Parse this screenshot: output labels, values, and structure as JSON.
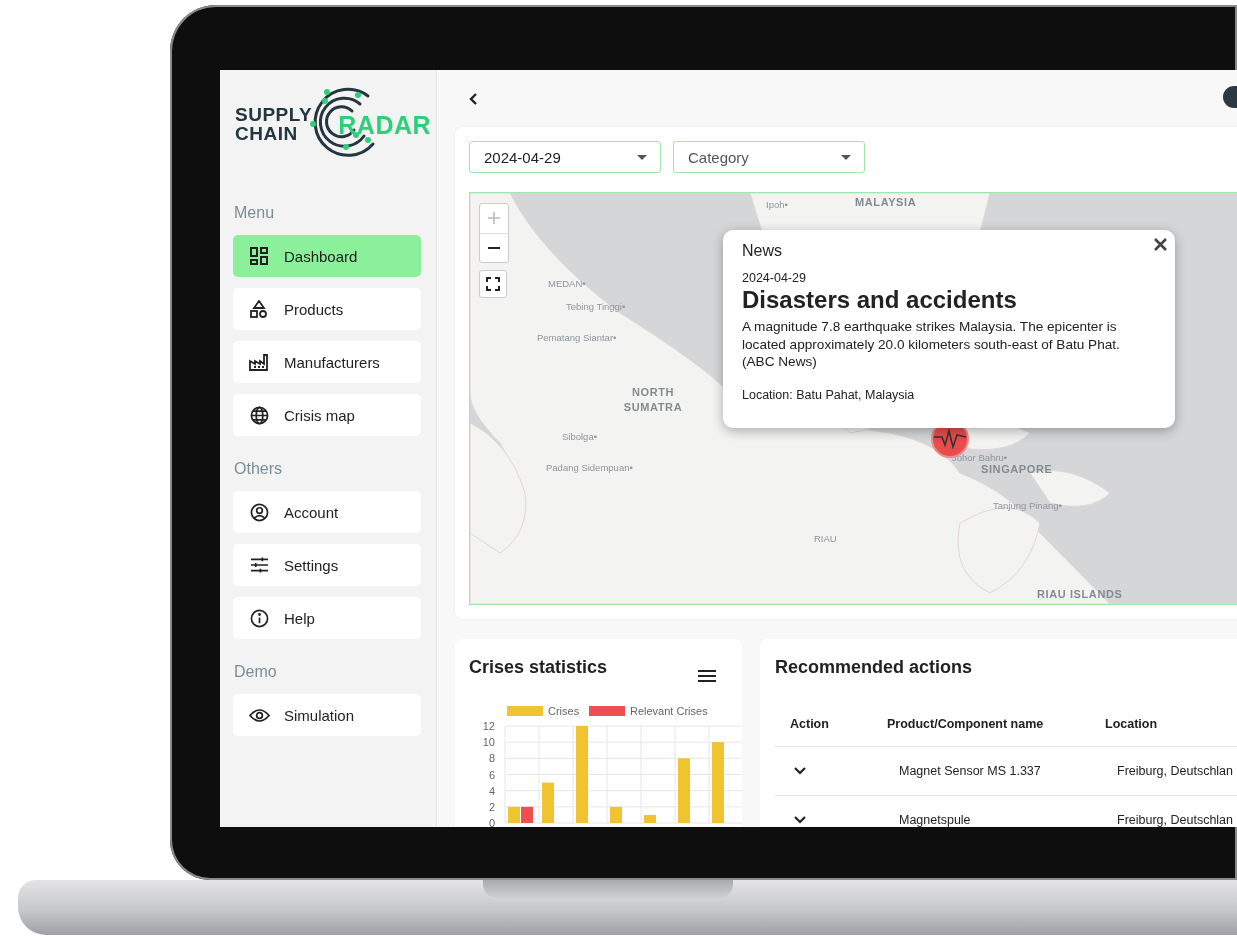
{
  "logo": {
    "line_1": "SUPPLY",
    "line_2": "CHAIN",
    "line_3": "RADAR"
  },
  "sidebar": {
    "sections": [
      {
        "heading": "Menu",
        "items": [
          {
            "label": "Dashboard",
            "selected": true
          },
          {
            "label": "Products",
            "selected": false
          },
          {
            "label": "Manufacturers",
            "selected": false
          },
          {
            "label": "Crisis map",
            "selected": false
          }
        ]
      },
      {
        "heading": "Others",
        "items": [
          {
            "label": "Account",
            "selected": false
          },
          {
            "label": "Settings",
            "selected": false
          },
          {
            "label": "Help",
            "selected": false
          }
        ]
      },
      {
        "heading": "Demo",
        "items": [
          {
            "label": "Simulation",
            "selected": false
          }
        ]
      }
    ]
  },
  "filters": {
    "date_select": {
      "value": "2024-04-29"
    },
    "category_select": {
      "placeholder": "Category"
    }
  },
  "map": {
    "labels": [
      "Ipoh•",
      "MALAYSIA",
      "MEDAN•",
      "Tebing Tinggi•",
      "Pematang Siantar•",
      "NORTH SUMATRA",
      "Sibolga•",
      "Padang Sidempuan•",
      "Johor Bahru•",
      "SINGAPORE",
      "Tanjung Pinang•",
      "RIAU",
      "RIAU ISLANDS"
    ],
    "popup": {
      "heading": "News",
      "date": "2024-04-29",
      "title": "Disasters and accidents",
      "body": "A magnitude 7.8 earthquake strikes Malaysia. The epicenter is located approximately 20.0 kilometers south-east of Batu Phat. (ABC News)",
      "location": "Location: Batu Pahat, Malaysia"
    }
  },
  "crises_statistics": {
    "title": "Crises statistics",
    "chart_data": {
      "type": "bar",
      "grid": true,
      "legend": "top",
      "ylim": [
        0,
        12
      ],
      "yticks": [
        0,
        2,
        4,
        6,
        8,
        10,
        12
      ],
      "series": [
        {
          "name": "Crises",
          "color": "#f0c330",
          "values": [
            2,
            5,
            12,
            2,
            1,
            8,
            10
          ]
        },
        {
          "name": "Relevant Crises",
          "color": "#ef4f4f",
          "values": [
            2,
            0,
            0,
            0,
            0,
            0,
            0
          ]
        }
      ]
    }
  },
  "recommended_actions": {
    "title": "Recommended actions",
    "columns": [
      "Action",
      "Product/Component name",
      "Location"
    ],
    "rows": [
      {
        "name": "Magnet Sensor MS 1.337",
        "location": "Freiburg, Deutschlan"
      },
      {
        "name": "Magnetspule",
        "location": "Freiburg, Deutschlan"
      }
    ]
  }
}
